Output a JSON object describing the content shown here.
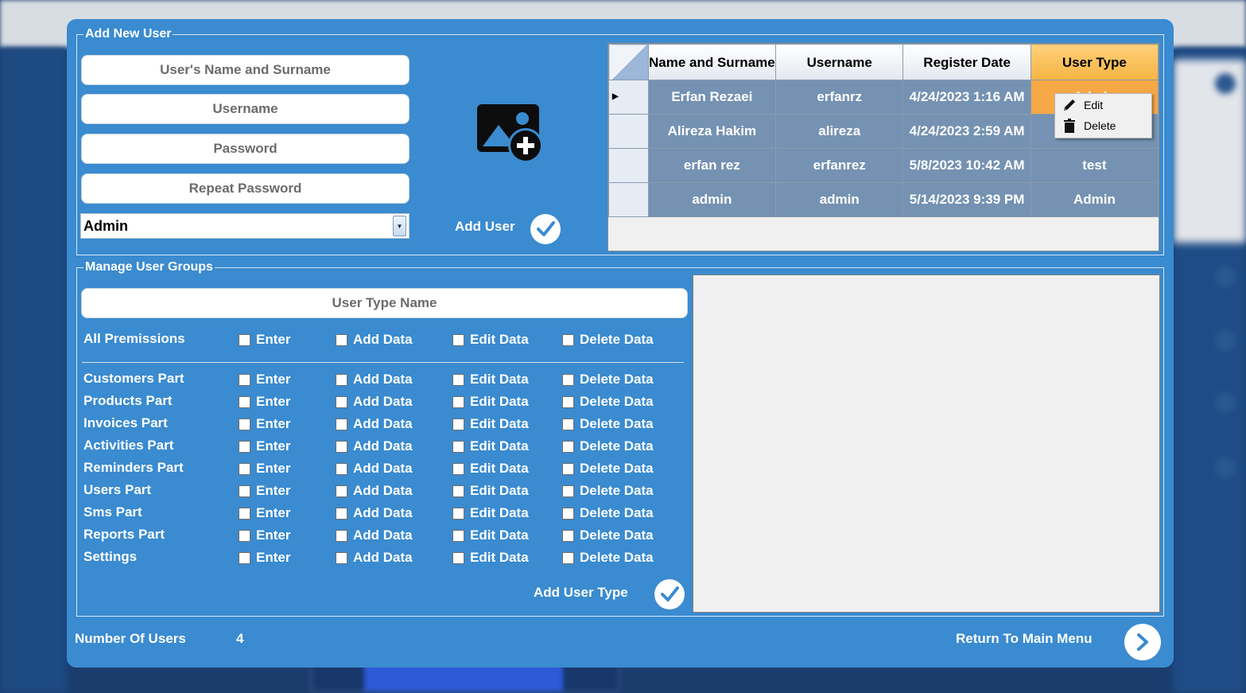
{
  "add_user": {
    "legend": "Add New User",
    "name_placeholder": "User's Name and Surname",
    "username_placeholder": "Username",
    "password_placeholder": "Password",
    "repeat_password_placeholder": "Repeat Password",
    "user_type_selected": "Admin",
    "add_user_label": "Add User",
    "image_icon": "add-photo-icon"
  },
  "users_grid": {
    "headers": [
      "Name and Surname",
      "Username",
      "Register Date",
      "User Type"
    ],
    "rows": [
      {
        "name": "Erfan Rezaei",
        "username": "erfanrz",
        "date": "4/24/2023 1:16 AM",
        "type": "Admin"
      },
      {
        "name": "Alireza Hakim",
        "username": "alireza",
        "date": "4/24/2023 2:59 AM",
        "type": ""
      },
      {
        "name": "erfan rez",
        "username": "erfanrez",
        "date": "5/8/2023 10:42 AM",
        "type": "test"
      },
      {
        "name": "admin",
        "username": "admin",
        "date": "5/14/2023 9:39 PM",
        "type": "Admin"
      }
    ]
  },
  "context_menu": {
    "edit": "Edit",
    "delete": "Delete"
  },
  "user_groups": {
    "legend": "Manage User Groups",
    "type_name_placeholder": "User Type Name",
    "columns": [
      "Enter",
      "Add Data",
      "Edit Data",
      "Delete Data"
    ],
    "all_permissions": "All Premissions",
    "parts": [
      "Customers Part",
      "Products Part",
      "Invoices Part",
      "Activities Part",
      "Reminders Part",
      "Users Part",
      "Sms Part",
      "Reports Part",
      "Settings"
    ],
    "add_type_label": "Add User Type"
  },
  "footer": {
    "count_label": "Number Of Users",
    "count_value": "4",
    "return_label": "Return To Main Menu"
  },
  "colors": {
    "dialog_bg": "#3a8bd0",
    "grid_row_bg": "#7592b2",
    "selected_header": "#f4b443"
  }
}
